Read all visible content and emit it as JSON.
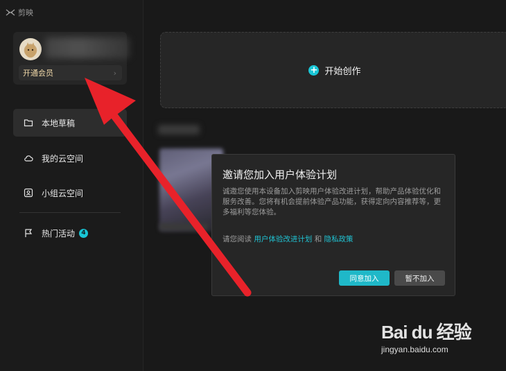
{
  "app": {
    "name": "剪映"
  },
  "sidebar": {
    "vip_label": "开通会员",
    "vip_chevron": "›",
    "items": [
      {
        "label": "本地草稿",
        "icon": "folder-icon"
      },
      {
        "label": "我的云空间",
        "icon": "cloud-icon"
      },
      {
        "label": "小组云空间",
        "icon": "team-cloud-icon"
      },
      {
        "label": "热门活动",
        "icon": "flag-icon",
        "badge": "4"
      }
    ]
  },
  "main": {
    "create_label": "开始创作",
    "create_plus": "+"
  },
  "dialog": {
    "title": "邀请您加入用户体验计划",
    "body": "诚邀您使用本设备加入剪映用户体验改进计划，帮助产品体验优化和服务改善。您将有机会提前体验产品功能，获得定向内容推荐等，更多福利等您体验。",
    "read_prefix": "请您阅读",
    "link_plan": "用户体验改进计划",
    "link_and": "和",
    "link_privacy": "隐私政策",
    "agree_label": "同意加入",
    "decline_label": "暂不加入"
  },
  "watermark": {
    "logo": "Bai du 经验",
    "url": "jingyan.baidu.com"
  },
  "colors": {
    "accent": "#1fb8c8",
    "arrow": "#e8222a",
    "vip": "#f0d8a8"
  }
}
